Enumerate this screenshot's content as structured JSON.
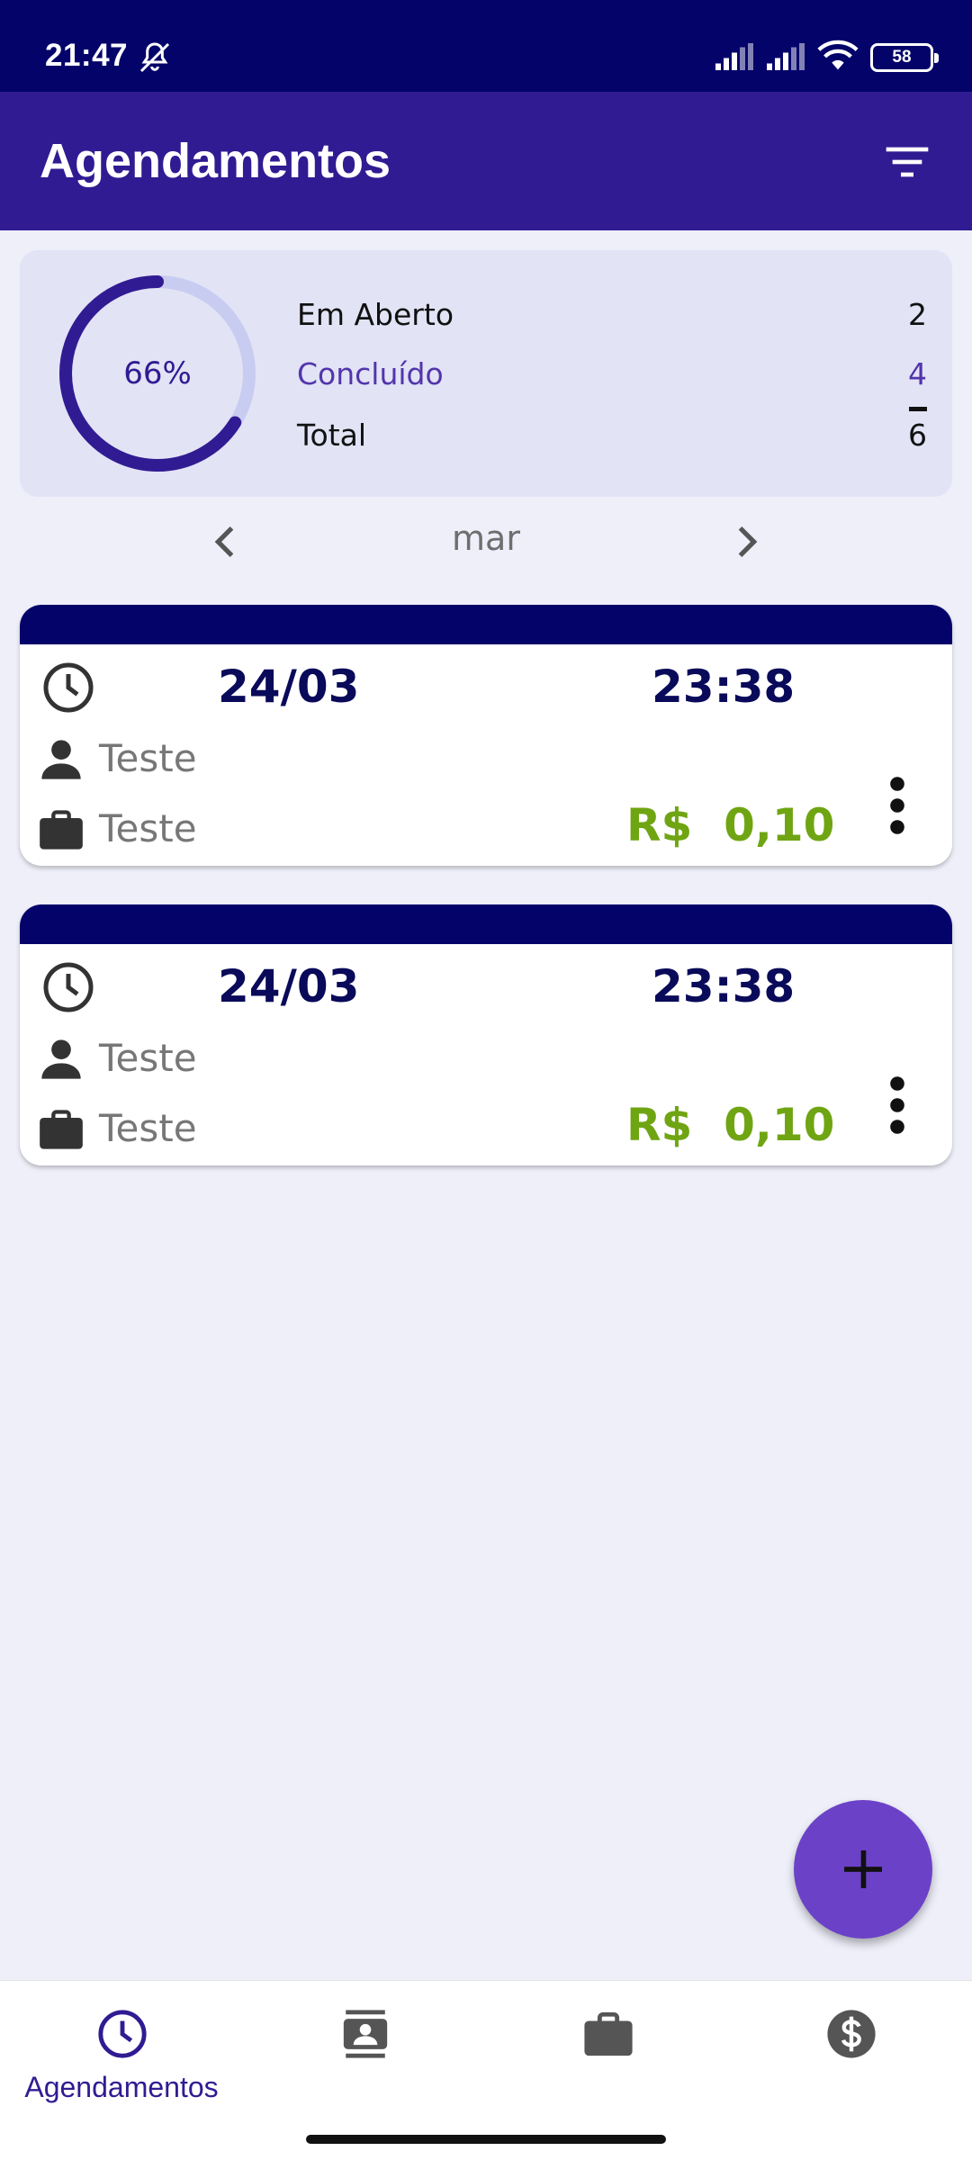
{
  "status_bar": {
    "time": "21:47",
    "battery": "58"
  },
  "app_bar": {
    "title": "Agendamentos"
  },
  "summary": {
    "percent": "66%",
    "percent_value": 0.66,
    "open_label": "Em Aberto",
    "open_value": "2",
    "done_label": "Concluído",
    "done_value": "4",
    "total_label": "Total",
    "total_value": "6"
  },
  "month_nav": {
    "label": "mar"
  },
  "appointments": [
    {
      "date": "24/03",
      "time": "23:38",
      "client": "Teste",
      "service": "Teste",
      "price": "R$  0,10"
    },
    {
      "date": "24/03",
      "time": "23:38",
      "client": "Teste",
      "service": "Teste",
      "price": "R$  0,10"
    }
  ],
  "bottom_nav": {
    "items": [
      {
        "label": "Agendamentos",
        "icon": "clock-icon",
        "active": true
      },
      {
        "label": "",
        "icon": "contacts-icon",
        "active": false
      },
      {
        "label": "",
        "icon": "briefcase-icon",
        "active": false
      },
      {
        "label": "",
        "icon": "dollar-icon",
        "active": false
      }
    ]
  },
  "colors": {
    "status_bar": "#04036a",
    "app_bar": "#311b92",
    "accent": "#6b42c7",
    "price": "#6fa513",
    "card_header": "#04036a"
  }
}
